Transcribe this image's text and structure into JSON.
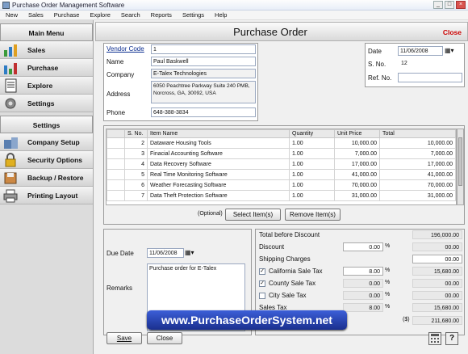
{
  "window": {
    "title": "Purchase Order Management Software"
  },
  "menu": [
    "New",
    "Sales",
    "Purchase",
    "Explore",
    "Search",
    "Reports",
    "Settings",
    "Help"
  ],
  "sidebar": {
    "main_menu_title": "Main Menu",
    "main_items": [
      {
        "label": "Sales",
        "icon": "sales-chart-icon"
      },
      {
        "label": "Purchase",
        "icon": "purchase-chart-icon"
      },
      {
        "label": "Explore",
        "icon": "explore-document-icon"
      },
      {
        "label": "Settings",
        "icon": "gear-icon"
      }
    ],
    "settings_title": "Settings",
    "settings_items": [
      {
        "label": "Company Setup",
        "icon": "company-setup-icon"
      },
      {
        "label": "Security Options",
        "icon": "security-lock-icon"
      },
      {
        "label": "Backup / Restore",
        "icon": "backup-restore-icon"
      },
      {
        "label": "Printing Layout",
        "icon": "printer-icon"
      }
    ]
  },
  "header": {
    "title": "Purchase Order",
    "close_label": "Close"
  },
  "vendor": {
    "code_label": "Vendor Code",
    "code": "1",
    "name_label": "Name",
    "name": "Paul Baskwell",
    "company_label": "Company",
    "company": "E-Talex Technologies",
    "address_label": "Address",
    "address": "6050 Peachtree Parkway Suite 240 PMB, Norcross, GA, 30092, USA",
    "phone_label": "Phone",
    "phone": "648-388-3834"
  },
  "order_info": {
    "date_label": "Date",
    "date": "11/06/2008",
    "sno_label": "S. No.",
    "sno": "12",
    "ref_label": "Ref. No.",
    "ref": ""
  },
  "items_table": {
    "headers": [
      "S. No.",
      "Item Name",
      "Quantity",
      "Unit Price",
      "Total"
    ],
    "rows": [
      [
        "2",
        "Dataware Housing Tools",
        "1.00",
        "10,000.00",
        "10,000.00"
      ],
      [
        "3",
        "Finacial Accounting Software",
        "1.00",
        "7,000.00",
        "7,000.00"
      ],
      [
        "4",
        "Data Recovery Software",
        "1.00",
        "17,000.00",
        "17,000.00"
      ],
      [
        "5",
        "Real Time Monitoring Software",
        "1.00",
        "41,000.00",
        "41,000.00"
      ],
      [
        "6",
        "Weather Forecasting Software",
        "1.00",
        "70,000.00",
        "70,000.00"
      ],
      [
        "7",
        "Data Theft Protection Software",
        "1.00",
        "31,000.00",
        "31,000.00"
      ]
    ],
    "optional_label": "(Optional)",
    "select_button": "Select Item(s)",
    "remove_button": "Remove Item(s)"
  },
  "due": {
    "due_date_label": "Due Date",
    "due_date": "11/06/2008",
    "remarks_label": "Remarks",
    "remarks": "Purchase order for E-Talex"
  },
  "totals": {
    "before_discount_label": "Total before Discount",
    "before_discount": "196,000.00",
    "discount_label": "Discount",
    "discount_pct": "0.00",
    "discount_amt": "00.00",
    "shipping_label": "Shipping Charges",
    "shipping": "00.00",
    "california_label": "California Sale Tax",
    "california_pct": "8.00",
    "california_amt": "15,680.00",
    "county_label": "County Sale Tax",
    "county_pct": "0.00",
    "county_amt": "00.00",
    "city_label": "City Sale Tax",
    "city_pct": "0.00",
    "city_amt": "00.00",
    "sales_tax_label": "Sales Tax",
    "sales_tax_pct": "8.00",
    "sales_tax_amt": "15,680.00",
    "currency_symbol": "($)",
    "grand_total": "211,680.00",
    "pct_symbol": "%"
  },
  "footer": {
    "save": "Save",
    "close": "Close"
  },
  "banner": "www.PurchaseOrderSystem.net"
}
